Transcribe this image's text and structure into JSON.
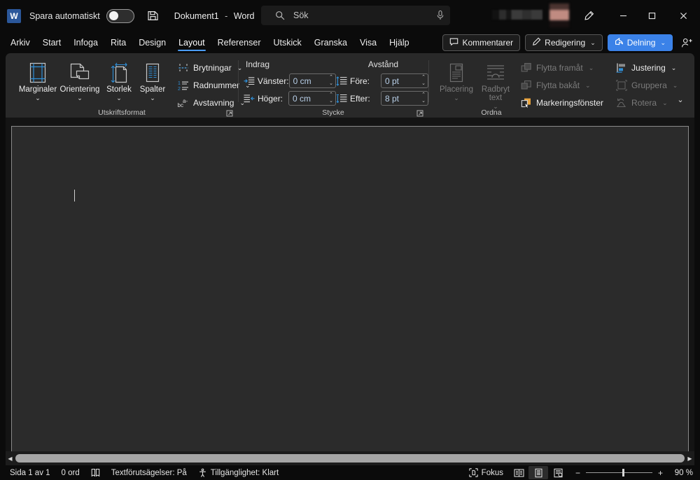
{
  "titlebar": {
    "logo_text": "W",
    "autosave_label": "Spara automatiskt",
    "autosave_state": "off",
    "save_icon": "save-icon",
    "document_name": "Dokument1",
    "separator": "-",
    "app_name": "Word",
    "search_placeholder": "Sök",
    "search_icon": "search-icon",
    "mic_icon": "microphone-icon",
    "account_name_redacted": "",
    "pen_icon": "pen-icon",
    "minimize_label": "",
    "maximize_label": "",
    "close_label": ""
  },
  "tabs": [
    {
      "label": "Arkiv",
      "active": false
    },
    {
      "label": "Start",
      "active": false
    },
    {
      "label": "Infoga",
      "active": false
    },
    {
      "label": "Rita",
      "active": false
    },
    {
      "label": "Design",
      "active": false
    },
    {
      "label": "Layout",
      "active": true
    },
    {
      "label": "Referenser",
      "active": false
    },
    {
      "label": "Utskick",
      "active": false
    },
    {
      "label": "Granska",
      "active": false
    },
    {
      "label": "Visa",
      "active": false
    },
    {
      "label": "Hjälp",
      "active": false
    }
  ],
  "tabstrip_right": {
    "comments_label": "Kommentarer",
    "editing_label": "Redigering",
    "share_label": "Delning",
    "chevron": "⌄",
    "share_accent_color": "#3b82e8"
  },
  "ribbon": {
    "collapse_chevron": "⌄",
    "groups": [
      {
        "name": "page-setup",
        "label": "Utskriftsformat",
        "big_buttons": [
          {
            "label": "Marginaler",
            "icon": "margins-icon",
            "chevron": "⌄",
            "disabled": false
          },
          {
            "label": "Orientering",
            "icon": "orientation-icon",
            "chevron": "⌄",
            "disabled": false
          },
          {
            "label": "Storlek",
            "icon": "size-icon",
            "chevron": "⌄",
            "disabled": false
          },
          {
            "label": "Spalter",
            "icon": "columns-icon",
            "chevron": "⌄",
            "disabled": false
          }
        ],
        "small_buttons": [
          {
            "label": "Brytningar",
            "icon": "breaks-icon",
            "chevron": "⌄",
            "disabled": false
          },
          {
            "label": "Radnummer",
            "icon": "line-numbers-icon",
            "chevron": "⌄",
            "disabled": false
          },
          {
            "label": "Avstavning",
            "icon": "hyphenation-icon",
            "chevron": "⌄",
            "disabled": false
          }
        ],
        "launcher_icon": "dialog-launcher-icon"
      },
      {
        "name": "paragraph",
        "label": "Stycke",
        "indent_header": "Indrag",
        "spacing_header": "Avstånd",
        "fields": [
          {
            "label": "Vänster:",
            "value": "0 cm",
            "icon": "indent-left-icon"
          },
          {
            "label": "Höger:",
            "value": "0 cm",
            "icon": "indent-right-icon"
          },
          {
            "label": "Före:",
            "value": "0 pt",
            "icon": "spacing-before-icon"
          },
          {
            "label": "Efter:",
            "value": "8 pt",
            "icon": "spacing-after-icon"
          }
        ],
        "launcher_icon": "dialog-launcher-icon"
      },
      {
        "name": "arrange",
        "label": "Ordna",
        "big_buttons": [
          {
            "label": "Placering",
            "icon": "position-icon",
            "chevron": "⌄",
            "disabled": true
          },
          {
            "label": "Radbryt text",
            "icon": "wrap-text-icon",
            "chevron": "⌄",
            "disabled": true
          }
        ],
        "small_buttons_col1": [
          {
            "label": "Flytta framåt",
            "icon": "bring-forward-icon",
            "chevron": "⌄",
            "disabled": true
          },
          {
            "label": "Flytta bakåt",
            "icon": "send-backward-icon",
            "chevron": "⌄",
            "disabled": true
          },
          {
            "label": "Markeringsfönster",
            "icon": "selection-pane-icon",
            "chevron": "",
            "disabled": false
          }
        ],
        "small_buttons_col2": [
          {
            "label": "Justering",
            "icon": "align-objects-icon",
            "chevron": "⌄",
            "disabled": false
          },
          {
            "label": "Gruppera",
            "icon": "group-icon",
            "chevron": "⌄",
            "disabled": true
          },
          {
            "label": "Rotera",
            "icon": "rotate-icon",
            "chevron": "⌄",
            "disabled": true
          }
        ]
      }
    ]
  },
  "document": {
    "page_background": "#2b2b2b",
    "caret_visible": true
  },
  "scrollbar": {
    "left_arrow": "◀",
    "right_arrow": "▶"
  },
  "statusbar": {
    "page_label": "Sida 1 av 1",
    "word_count": "0 ord",
    "proofing_icon": "proofing-icon",
    "text_predictions": "Textförutsägelser: På",
    "accessibility_icon": "accessibility-icon",
    "accessibility": "Tillgänglighet: Klart",
    "focus_label": "Fokus",
    "focus_icon": "focus-icon",
    "view_read_icon": "read-mode-icon",
    "view_print_icon": "print-layout-icon",
    "view_web_icon": "web-layout-icon",
    "zoom_out": "−",
    "zoom_in": "+",
    "zoom_value": "90 %",
    "zoom_percent": 90
  }
}
